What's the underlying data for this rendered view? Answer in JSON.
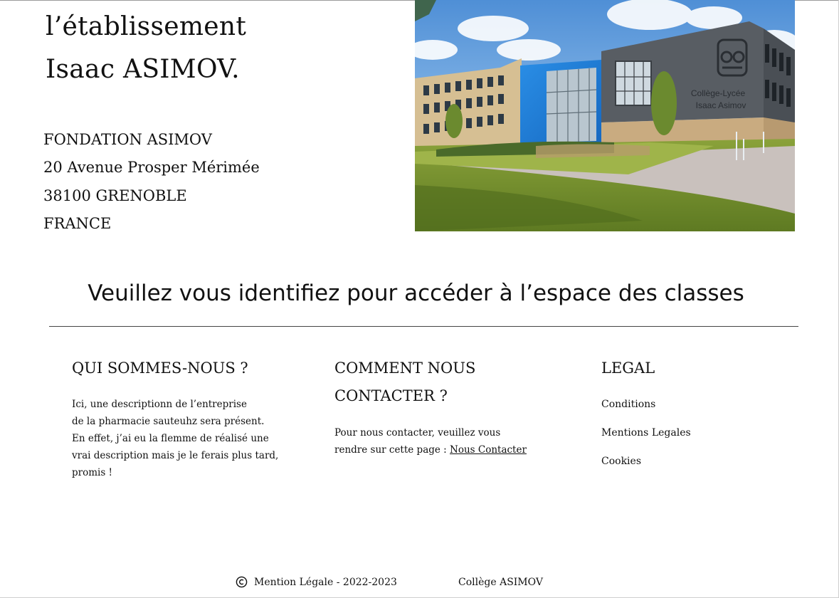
{
  "hero": {
    "title_line1": "l’établissement",
    "title_line2": "Isaac ASIMOV."
  },
  "address": {
    "line1": "FONDATION ASIMOV",
    "line2": "20 Avenue Prosper Mérimée",
    "line3": "38100 GRENOBLE",
    "line4": "FRANCE"
  },
  "school_image": {
    "sign_line1": "Collège-Lycée",
    "sign_line2": "Isaac Asimov"
  },
  "login_prompt": "Veuillez vous identifiez pour accéder à l’espace des classes",
  "columns": {
    "about": {
      "title": "QUI SOMMES-NOUS ?",
      "lines": [
        "Ici,  une descriptionn de l’entreprise",
        "de la pharmacie sauteuhz sera présent.",
        "En effet, j’ai eu la flemme de réalisé une",
        "vrai description mais je le ferais plus tard,",
        "promis !"
      ]
    },
    "contact": {
      "title_line1": "COMMENT NOUS",
      "title_line2": "CONTACTER ?",
      "text_line1": "Pour nous contacter, veuillez vous",
      "text_line2_prefix": "rendre sur cette page : ",
      "link_label": "Nous Contacter"
    },
    "legal": {
      "title": "LEGAL",
      "links": [
        "Conditions",
        "Mentions Legales",
        "Cookies"
      ]
    }
  },
  "footer": {
    "copyright_text": "Mention Légale - 2022-2023",
    "school_name": "Collège ASIMOV"
  },
  "colors": {
    "text": "#111111",
    "divider": "#444444",
    "background": "#ffffff"
  }
}
